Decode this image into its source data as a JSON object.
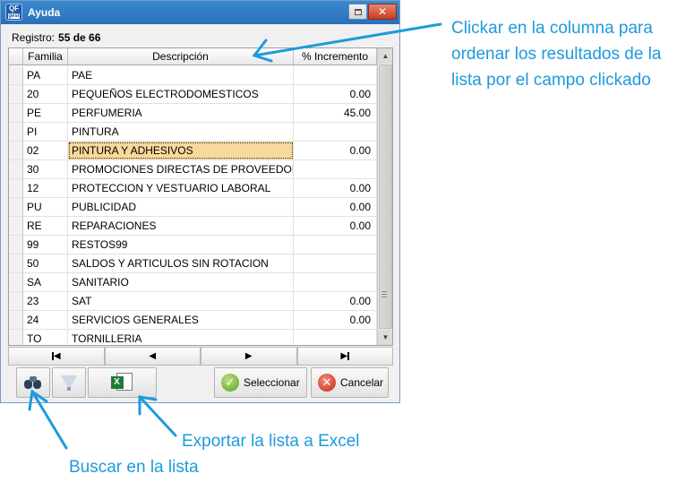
{
  "window": {
    "title": "Ayuda",
    "icon_text": "QF",
    "icon_sub": "gest",
    "close_glyph": "✕"
  },
  "registro": {
    "label": "Registro:",
    "value": "55 de 66"
  },
  "grid": {
    "columns": [
      "Familia",
      "Descripción",
      "% Incremento"
    ],
    "rows": [
      {
        "familia": "PA",
        "descripcion": "PAE",
        "incremento": ""
      },
      {
        "familia": "20",
        "descripcion": "PEQUEÑOS ELECTRODOMESTICOS",
        "incremento": "0.00"
      },
      {
        "familia": "PE",
        "descripcion": "PERFUMERIA",
        "incremento": "45.00"
      },
      {
        "familia": "PI",
        "descripcion": "PINTURA",
        "incremento": ""
      },
      {
        "familia": "02",
        "descripcion": "PINTURA Y ADHESIVOS",
        "incremento": "0.00"
      },
      {
        "familia": "30",
        "descripcion": "PROMOCIONES DIRECTAS DE PROVEEDORES",
        "incremento": ""
      },
      {
        "familia": "12",
        "descripcion": "PROTECCION Y VESTUARIO LABORAL",
        "incremento": "0.00"
      },
      {
        "familia": "PU",
        "descripcion": "PUBLICIDAD",
        "incremento": "0.00"
      },
      {
        "familia": "RE",
        "descripcion": "REPARACIONES",
        "incremento": "0.00"
      },
      {
        "familia": "99",
        "descripcion": "RESTOS99",
        "incremento": ""
      },
      {
        "familia": "50",
        "descripcion": "SALDOS Y ARTICULOS SIN ROTACION",
        "incremento": ""
      },
      {
        "familia": "SA",
        "descripcion": "SANITARIO",
        "incremento": ""
      },
      {
        "familia": "23",
        "descripcion": "SAT",
        "incremento": "0.00"
      },
      {
        "familia": "24",
        "descripcion": "SERVICIOS GENERALES",
        "incremento": "0.00"
      },
      {
        "familia": "TO",
        "descripcion": "TORNILLERIA",
        "incremento": ""
      }
    ]
  },
  "buttons": {
    "select": "Seleccionar",
    "cancel": "Cancelar"
  },
  "annotations": {
    "sort": "Clickar en la columna para ordenar los resultados de la lista por el campo clickado",
    "excel": "Exportar la lista a Excel",
    "search": "Buscar en la lista"
  },
  "colors": {
    "titlebar": "#2a70b8",
    "selected_cell": "#f8d99c",
    "annotation": "#1e9adc"
  }
}
